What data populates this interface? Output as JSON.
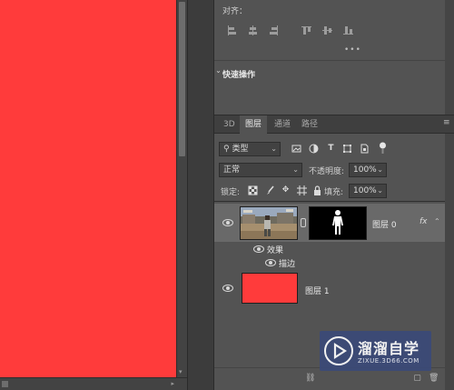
{
  "align": {
    "title": "对齐：",
    "more": "•••"
  },
  "quick_actions": {
    "title": "快速操作"
  },
  "tabs": [
    {
      "label": "3D"
    },
    {
      "label": "图层"
    },
    {
      "label": "通道"
    },
    {
      "label": "路径"
    }
  ],
  "filter": {
    "label": "类型"
  },
  "blend": {
    "mode": "正常",
    "opacity_label": "不透明度:",
    "opacity_value": "100%"
  },
  "lock": {
    "label": "锁定:",
    "fill_label": "填充:",
    "fill_value": "100%"
  },
  "layers": [
    {
      "name": "图层 0",
      "fx": "fx",
      "effects_label": "效果",
      "stroke_label": "描边"
    },
    {
      "name": "图层 1"
    }
  ],
  "watermark": {
    "title": "溜溜自学",
    "url": "ZIXUE.3D66.COM"
  },
  "colors": {
    "canvas_fill": "#ff3b3b",
    "panel_bg": "#535353",
    "selected_layer": "#696969",
    "watermark_bg": "#3b4a78"
  }
}
